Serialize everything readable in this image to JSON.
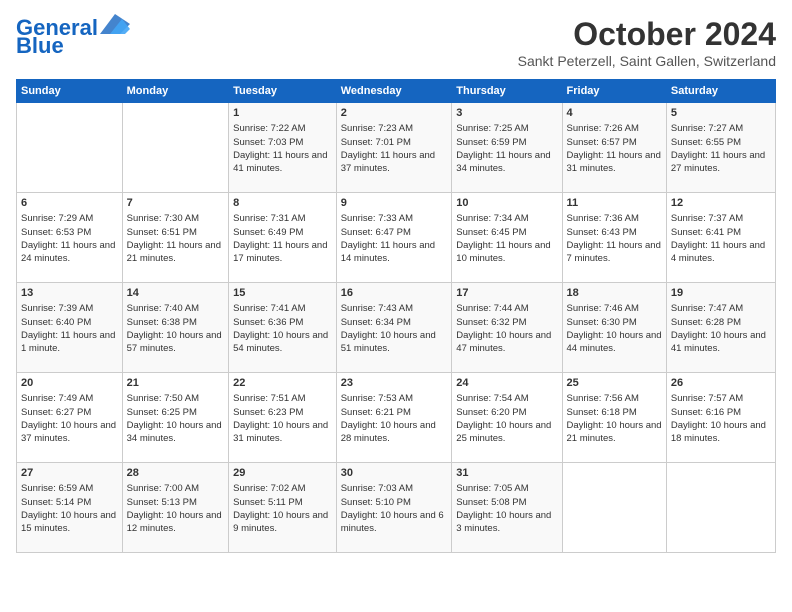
{
  "header": {
    "logo_line1": "General",
    "logo_line2": "Blue",
    "month": "October 2024",
    "location": "Sankt Peterzell, Saint Gallen, Switzerland"
  },
  "weekdays": [
    "Sunday",
    "Monday",
    "Tuesday",
    "Wednesday",
    "Thursday",
    "Friday",
    "Saturday"
  ],
  "weeks": [
    [
      {
        "day": "",
        "info": ""
      },
      {
        "day": "",
        "info": ""
      },
      {
        "day": "1",
        "info": "Sunrise: 7:22 AM\nSunset: 7:03 PM\nDaylight: 11 hours and 41 minutes."
      },
      {
        "day": "2",
        "info": "Sunrise: 7:23 AM\nSunset: 7:01 PM\nDaylight: 11 hours and 37 minutes."
      },
      {
        "day": "3",
        "info": "Sunrise: 7:25 AM\nSunset: 6:59 PM\nDaylight: 11 hours and 34 minutes."
      },
      {
        "day": "4",
        "info": "Sunrise: 7:26 AM\nSunset: 6:57 PM\nDaylight: 11 hours and 31 minutes."
      },
      {
        "day": "5",
        "info": "Sunrise: 7:27 AM\nSunset: 6:55 PM\nDaylight: 11 hours and 27 minutes."
      }
    ],
    [
      {
        "day": "6",
        "info": "Sunrise: 7:29 AM\nSunset: 6:53 PM\nDaylight: 11 hours and 24 minutes."
      },
      {
        "day": "7",
        "info": "Sunrise: 7:30 AM\nSunset: 6:51 PM\nDaylight: 11 hours and 21 minutes."
      },
      {
        "day": "8",
        "info": "Sunrise: 7:31 AM\nSunset: 6:49 PM\nDaylight: 11 hours and 17 minutes."
      },
      {
        "day": "9",
        "info": "Sunrise: 7:33 AM\nSunset: 6:47 PM\nDaylight: 11 hours and 14 minutes."
      },
      {
        "day": "10",
        "info": "Sunrise: 7:34 AM\nSunset: 6:45 PM\nDaylight: 11 hours and 10 minutes."
      },
      {
        "day": "11",
        "info": "Sunrise: 7:36 AM\nSunset: 6:43 PM\nDaylight: 11 hours and 7 minutes."
      },
      {
        "day": "12",
        "info": "Sunrise: 7:37 AM\nSunset: 6:41 PM\nDaylight: 11 hours and 4 minutes."
      }
    ],
    [
      {
        "day": "13",
        "info": "Sunrise: 7:39 AM\nSunset: 6:40 PM\nDaylight: 11 hours and 1 minute."
      },
      {
        "day": "14",
        "info": "Sunrise: 7:40 AM\nSunset: 6:38 PM\nDaylight: 10 hours and 57 minutes."
      },
      {
        "day": "15",
        "info": "Sunrise: 7:41 AM\nSunset: 6:36 PM\nDaylight: 10 hours and 54 minutes."
      },
      {
        "day": "16",
        "info": "Sunrise: 7:43 AM\nSunset: 6:34 PM\nDaylight: 10 hours and 51 minutes."
      },
      {
        "day": "17",
        "info": "Sunrise: 7:44 AM\nSunset: 6:32 PM\nDaylight: 10 hours and 47 minutes."
      },
      {
        "day": "18",
        "info": "Sunrise: 7:46 AM\nSunset: 6:30 PM\nDaylight: 10 hours and 44 minutes."
      },
      {
        "day": "19",
        "info": "Sunrise: 7:47 AM\nSunset: 6:28 PM\nDaylight: 10 hours and 41 minutes."
      }
    ],
    [
      {
        "day": "20",
        "info": "Sunrise: 7:49 AM\nSunset: 6:27 PM\nDaylight: 10 hours and 37 minutes."
      },
      {
        "day": "21",
        "info": "Sunrise: 7:50 AM\nSunset: 6:25 PM\nDaylight: 10 hours and 34 minutes."
      },
      {
        "day": "22",
        "info": "Sunrise: 7:51 AM\nSunset: 6:23 PM\nDaylight: 10 hours and 31 minutes."
      },
      {
        "day": "23",
        "info": "Sunrise: 7:53 AM\nSunset: 6:21 PM\nDaylight: 10 hours and 28 minutes."
      },
      {
        "day": "24",
        "info": "Sunrise: 7:54 AM\nSunset: 6:20 PM\nDaylight: 10 hours and 25 minutes."
      },
      {
        "day": "25",
        "info": "Sunrise: 7:56 AM\nSunset: 6:18 PM\nDaylight: 10 hours and 21 minutes."
      },
      {
        "day": "26",
        "info": "Sunrise: 7:57 AM\nSunset: 6:16 PM\nDaylight: 10 hours and 18 minutes."
      }
    ],
    [
      {
        "day": "27",
        "info": "Sunrise: 6:59 AM\nSunset: 5:14 PM\nDaylight: 10 hours and 15 minutes."
      },
      {
        "day": "28",
        "info": "Sunrise: 7:00 AM\nSunset: 5:13 PM\nDaylight: 10 hours and 12 minutes."
      },
      {
        "day": "29",
        "info": "Sunrise: 7:02 AM\nSunset: 5:11 PM\nDaylight: 10 hours and 9 minutes."
      },
      {
        "day": "30",
        "info": "Sunrise: 7:03 AM\nSunset: 5:10 PM\nDaylight: 10 hours and 6 minutes."
      },
      {
        "day": "31",
        "info": "Sunrise: 7:05 AM\nSunset: 5:08 PM\nDaylight: 10 hours and 3 minutes."
      },
      {
        "day": "",
        "info": ""
      },
      {
        "day": "",
        "info": ""
      }
    ]
  ]
}
